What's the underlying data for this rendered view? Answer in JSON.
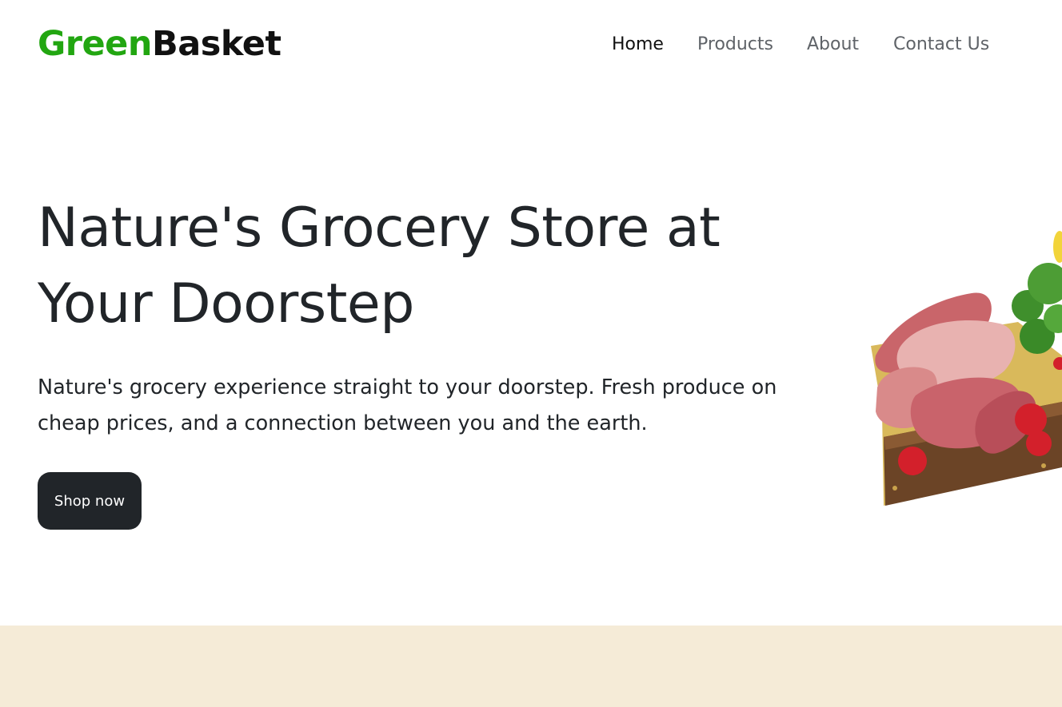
{
  "brand": {
    "part1": "Green",
    "part2": "Basket",
    "green": "#22a611",
    "dark": "#111111"
  },
  "nav": {
    "home": "Home",
    "products": "Products",
    "about": "About",
    "contact": "Contact Us"
  },
  "hero": {
    "title": "Nature's Grocery Store at Your Doorstep",
    "text": "Nature's grocery experience straight to your doorstep. Fresh produce on cheap prices, and a connection between you and the earth.",
    "button": "Shop now"
  },
  "colors": {
    "button_bg": "#212529",
    "band_bg": "#f5ebd7"
  }
}
